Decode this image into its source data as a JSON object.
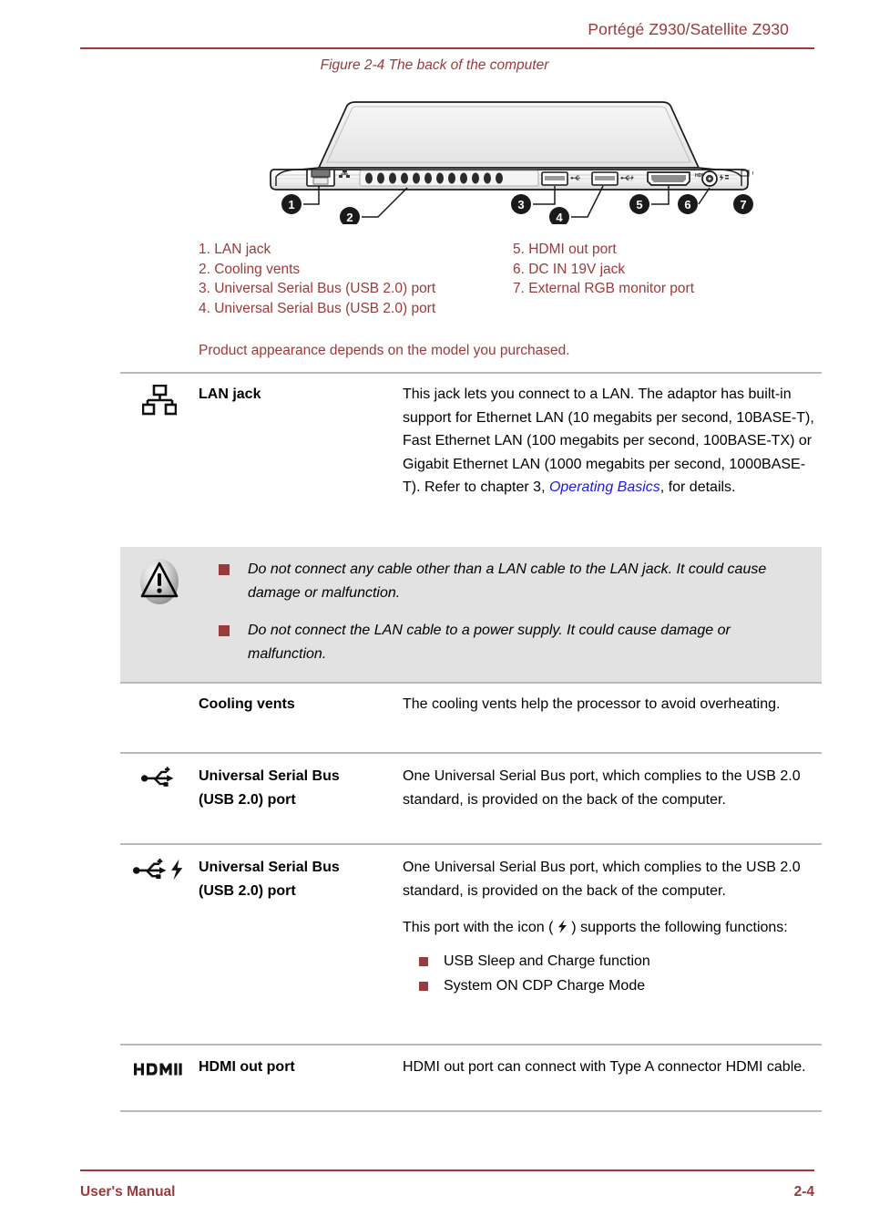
{
  "header": {
    "title": "Portégé Z930/Satellite Z930"
  },
  "figure": {
    "caption": "Figure 2-4 The back of the computer",
    "callouts": [
      "1",
      "2",
      "3",
      "4",
      "5",
      "6",
      "7"
    ]
  },
  "legend": {
    "column_left": [
      "1. LAN jack",
      "2. Cooling vents",
      "3. Universal Serial Bus (USB 2.0) port",
      "4. Universal Serial Bus (USB 2.0) port"
    ],
    "column_right": [
      "5. HDMI out port",
      "6. DC IN 19V jack",
      "7. External RGB monitor port"
    ]
  },
  "note": "Product appearance depends on the model you purchased.",
  "spec_rows": [
    {
      "icon": "lan-jack-icon",
      "term": "LAN jack",
      "definition_before_link": "This jack lets you connect to a LAN. The adaptor has built-in support for Ethernet LAN (10 megabits per second, 10BASE-T), Fast Ethernet LAN (100 megabits per second, 100BASE-TX) or Gigabit Ethernet LAN (1000 megabits per second, 1000BASE-T). Refer to chapter 3, ",
      "link_text": "Operating Basics",
      "definition_after_link": ", for details."
    },
    {
      "icon": "none",
      "term": "Cooling vents",
      "definition": "The cooling vents help the processor to avoid overheating."
    },
    {
      "icon": "usb-icon",
      "term_line1": "Universal Serial Bus",
      "term_line2": "(USB 2.0) port",
      "definition": "One Universal Serial Bus port, which complies to the USB 2.0 standard, is provided on the back of the computer."
    },
    {
      "icon": "usb-charge-icon",
      "term_line1": "Universal Serial Bus",
      "term_line2": "(USB 2.0) port",
      "definition": "One Universal Serial Bus port, which complies to the USB 2.0 standard, is provided on the back of the computer.",
      "definition2_prefix": "This port with the icon ( ",
      "definition2_suffix": " ) supports the following functions:",
      "bullets": [
        "USB Sleep and Charge function",
        "System ON CDP Charge Mode"
      ]
    },
    {
      "icon": "hdmi-icon",
      "term": "HDMI out port",
      "definition": "HDMI out port can connect with Type A connector HDMI cable."
    }
  ],
  "warning": {
    "icon": "warning-triangle-icon",
    "items": [
      "Do not connect any cable other than a LAN cable to the LAN jack. It could cause damage or malfunction.",
      "Do not connect the LAN cable to a power supply. It could cause damage or malfunction."
    ]
  },
  "footer": {
    "left": "User's Manual",
    "right": "2-4"
  },
  "colors": {
    "accent": "#9B3A3A",
    "link": "#1a1ae0",
    "rule": "#b9b9b9",
    "warning_bg": "#e2e2e2"
  }
}
